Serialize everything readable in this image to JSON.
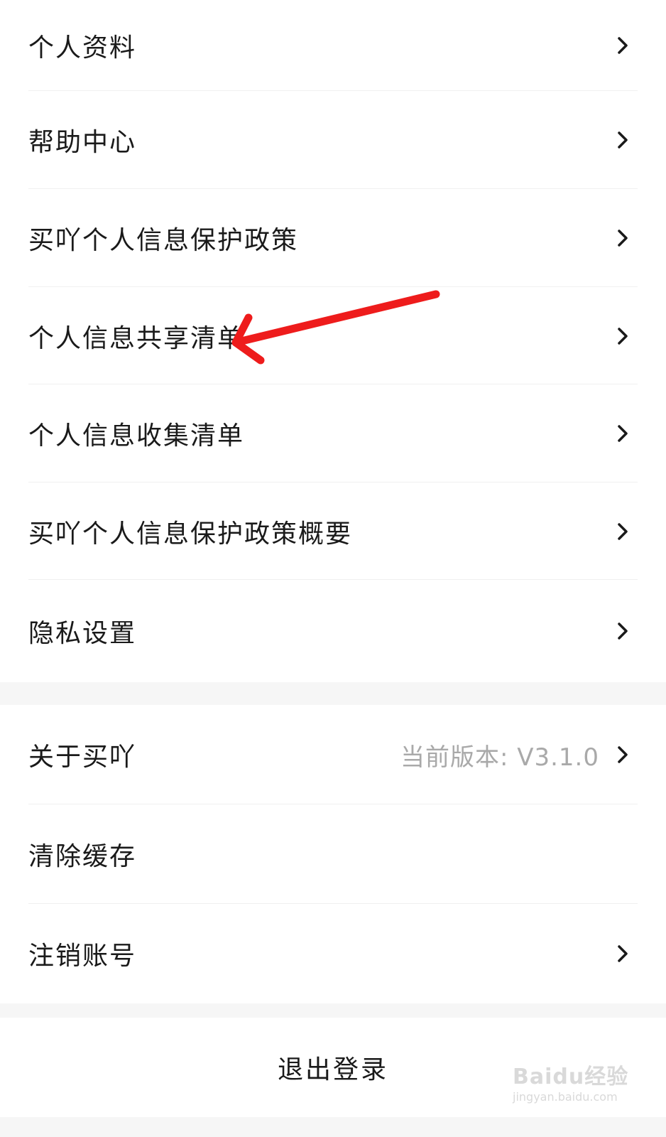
{
  "settings_section_1": {
    "items": [
      {
        "label": "个人资料"
      },
      {
        "label": "帮助中心"
      },
      {
        "label": "买吖个人信息保护政策"
      },
      {
        "label": "个人信息共享清单"
      },
      {
        "label": "个人信息收集清单"
      },
      {
        "label": "买吖个人信息保护政策概要"
      },
      {
        "label": "隐私设置"
      }
    ]
  },
  "settings_section_2": {
    "about": {
      "label": "关于买吖",
      "value": "当前版本: V3.1.0"
    },
    "clear_cache": {
      "label": "清除缓存"
    },
    "delete_account": {
      "label": "注销账号"
    }
  },
  "logout": {
    "label": "退出登录"
  },
  "annotation": {
    "arrow_color": "#ee1c1c",
    "target": "个人信息共享清单"
  },
  "watermark": {
    "main": "Baidu经验",
    "sub": "jingyan.baidu.com"
  },
  "icons": {
    "row_chevron": "chevron-right-icon"
  },
  "colors": {
    "background": "#f6f6f6",
    "card": "#ffffff",
    "secondary_text": "#a9a9a9"
  }
}
